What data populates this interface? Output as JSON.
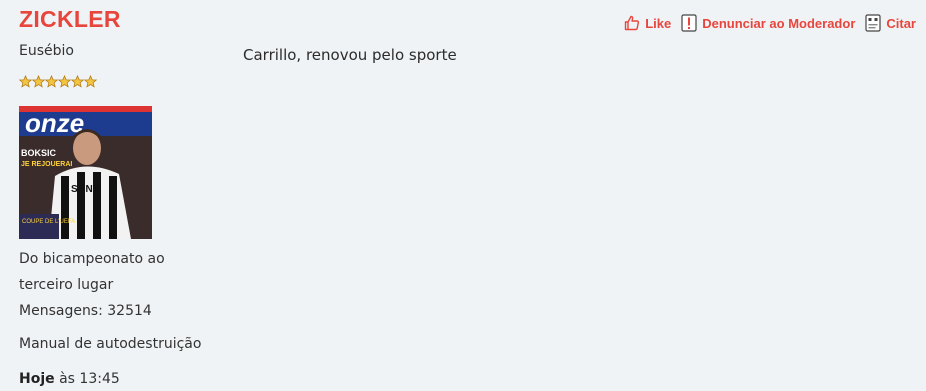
{
  "post": {
    "username": "ZICKLER",
    "rank": "Eusébio",
    "rating_stars": 6,
    "avatar_alt": "onze",
    "user_title_line1": "Do bicampeonato ao",
    "user_title_line2": "terceiro lugar",
    "messages_label": "Mensagens: 32514",
    "signature_tag": "Manual de autodestruição",
    "date_day": "Hoje",
    "date_time": "às 13:45",
    "message_text": "Carrillo, renovou pelo sporte"
  },
  "actions": {
    "like_label": "Like",
    "report_label": "Denunciar ao Moderador",
    "quote_label": "Citar"
  },
  "colors": {
    "accent": "#e8453c",
    "background": "#f0f3f6"
  },
  "icons": [
    "thumbs-up-icon",
    "report-icon",
    "quote-icon",
    "star-icon"
  ]
}
